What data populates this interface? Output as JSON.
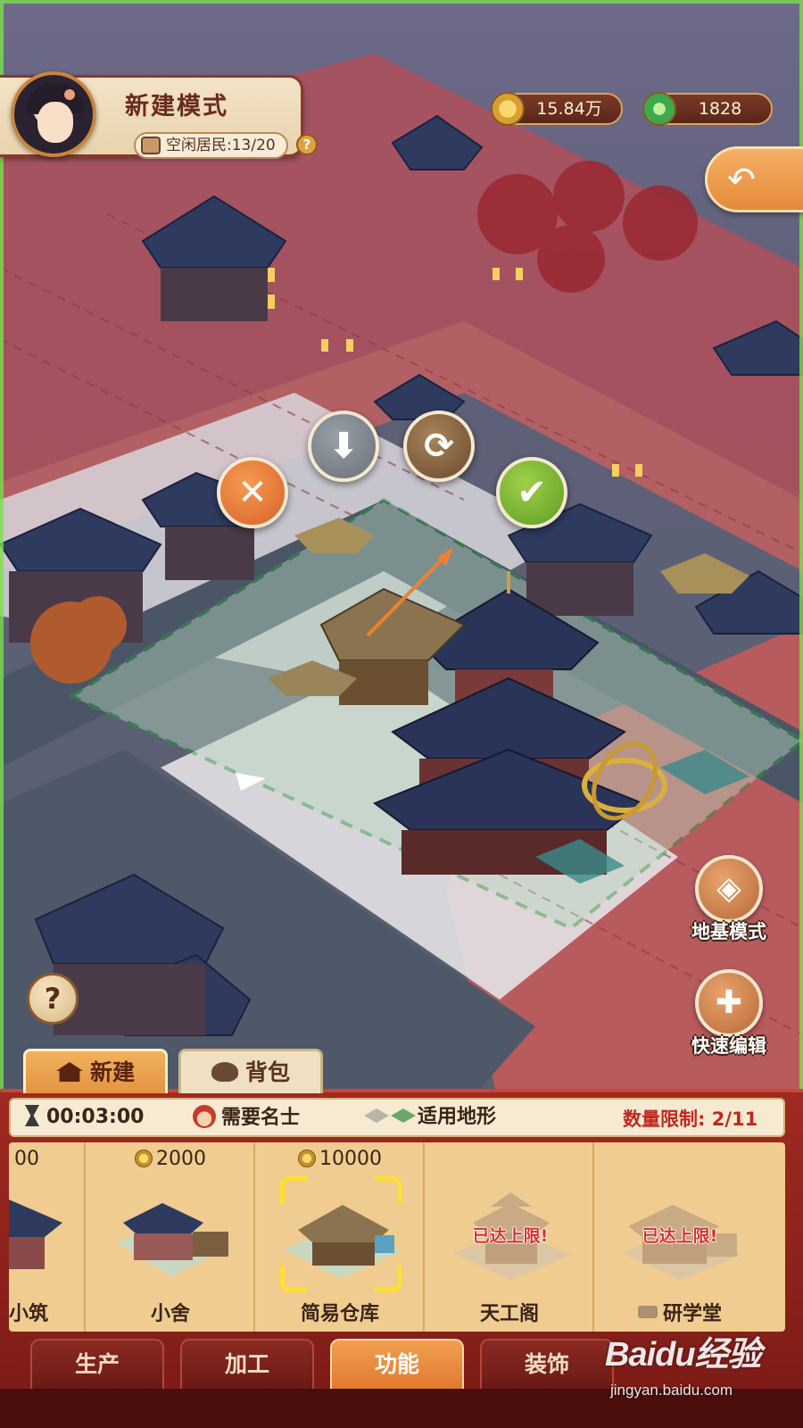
{
  "hud": {
    "mode_title": "新建模式",
    "idle_residents": "空闲居民:13/20",
    "help_small": "?",
    "coins": "15.84万",
    "jade": "1828"
  },
  "actions": {
    "cancel_glyph": "✕",
    "store_glyph": "⬇",
    "rotate_glyph": "⟳",
    "confirm_glyph": "✔"
  },
  "side": {
    "foundation_mode": "地基模式",
    "quick_edit": "快速编辑",
    "help": "?"
  },
  "tabs": {
    "new_build": "新建",
    "backpack": "背包"
  },
  "info": {
    "timer": "00:03:00",
    "requirement": "需要名士",
    "terrain": "适用地形",
    "limit": "数量限制: 2/11"
  },
  "cards": [
    {
      "price": "00",
      "name": "小筑",
      "maxed": ""
    },
    {
      "price": "2000",
      "name": "小舍",
      "maxed": ""
    },
    {
      "price": "10000",
      "name": "简易仓库",
      "maxed": ""
    },
    {
      "price": "",
      "name": "天工阁",
      "maxed": "已达上限!"
    },
    {
      "price": "",
      "name": "研学堂",
      "maxed": "已达上限!"
    }
  ],
  "categories": [
    "生产",
    "加工",
    "功能",
    "装饰"
  ],
  "watermark": {
    "logo": "Baidu经验",
    "url": "jingyan.baidu.com"
  },
  "colors": {
    "accent_orange": "#e48a3a",
    "panel_red": "#a02a22",
    "confirm_green": "#5f9c22",
    "cancel_orange": "#d8622a",
    "limit_red": "#c0281e"
  }
}
